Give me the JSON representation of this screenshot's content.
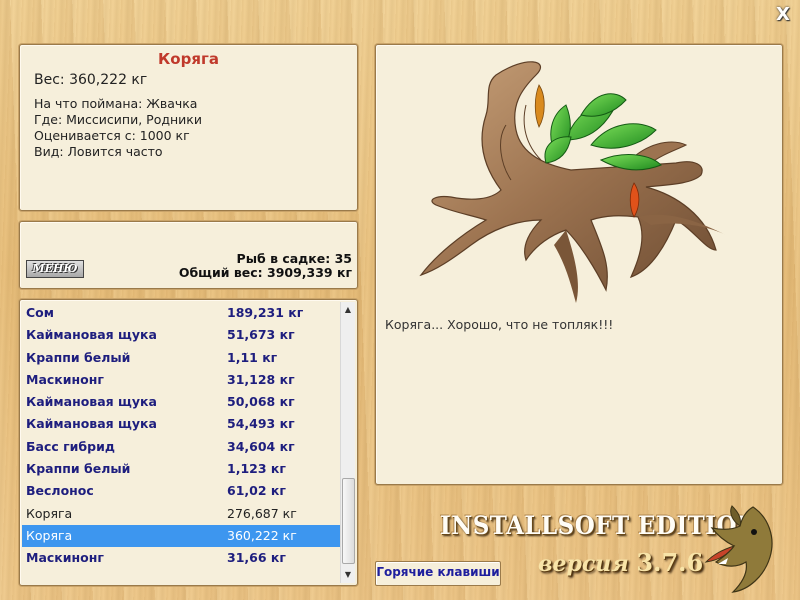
{
  "close_label": "X",
  "info": {
    "title": "Коряга",
    "weight": "Вес: 360,222 кг",
    "caught_on": "На что поймана: Жвачка",
    "where": "Где: Миссисипи, Родники",
    "valued_from": "Оценивается с: 1000 кг",
    "kind": "Вид: Ловится часто"
  },
  "stats": {
    "menu_label": "МЕНЮ",
    "fish_count": "Рыб в садке: 35",
    "total_weight": "Общий вес: 3909,339 кг"
  },
  "catch_list": [
    {
      "name": "Сом",
      "weight": "189,231 кг",
      "style": "bold"
    },
    {
      "name": "Каймановая щука",
      "weight": "51,673 кг",
      "style": "bold"
    },
    {
      "name": "Краппи белый",
      "weight": "1,11 кг",
      "style": "bold"
    },
    {
      "name": "Маскинонг",
      "weight": "31,128 кг",
      "style": "bold"
    },
    {
      "name": "Каймановая щука",
      "weight": "50,068 кг",
      "style": "bold"
    },
    {
      "name": "Каймановая щука",
      "weight": "54,493 кг",
      "style": "bold"
    },
    {
      "name": "Басс гибрид",
      "weight": "34,604 кг",
      "style": "bold"
    },
    {
      "name": "Краппи белый",
      "weight": "1,123 кг",
      "style": "bold"
    },
    {
      "name": "Веслонос",
      "weight": "61,02 кг",
      "style": "bold"
    },
    {
      "name": "Коряга",
      "weight": "276,687 кг",
      "style": "plain"
    },
    {
      "name": "Коряга",
      "weight": "360,222 кг",
      "style": "selected"
    },
    {
      "name": "Маскинонг",
      "weight": "31,66 кг",
      "style": "bold"
    }
  ],
  "caption": "Коряга... Хорошо, что не топляк!!!",
  "hotkeys_label": "Горячие клавиши",
  "branding": {
    "edition": "INSTALLSOFT EDITION",
    "version_word": "версия",
    "version_number": "3.7.6"
  },
  "colors": {
    "title_red": "#c0392b",
    "fish_name_blue": "#1e1e7e",
    "selection_blue": "#3d96ef",
    "panel_bg": "#f6efdb"
  },
  "icons": {
    "close": "close-icon",
    "scroll_up": "triangle-up-icon",
    "scroll_down": "triangle-down-icon",
    "logo": "pike-fish-logo"
  }
}
